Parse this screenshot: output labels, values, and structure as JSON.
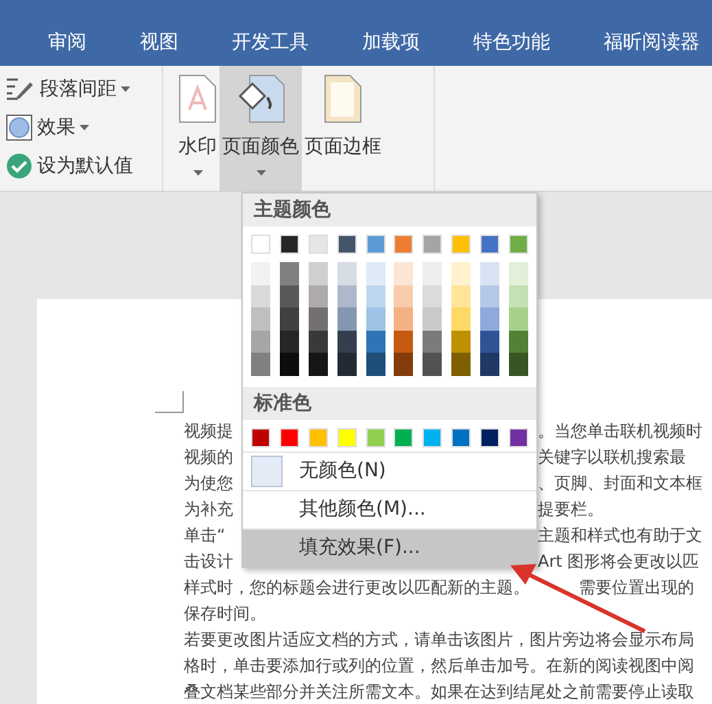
{
  "tabs": [
    {
      "label": "审阅",
      "selected": false
    },
    {
      "label": "视图",
      "selected": false
    },
    {
      "label": "开发工具",
      "selected": false
    },
    {
      "label": "加载项",
      "selected": false
    },
    {
      "label": "特色功能",
      "selected": false
    },
    {
      "label": "福昕阅读器",
      "selected": false
    }
  ],
  "ribbon": {
    "small_buttons": [
      {
        "kind": "spacing",
        "label": "段落间距",
        "dropdown": true
      },
      {
        "kind": "effects",
        "label": "效果",
        "dropdown": true
      },
      {
        "kind": "default",
        "label": "设为默认值",
        "dropdown": false
      }
    ],
    "large_buttons": [
      {
        "kind": "watermark",
        "label": "水印",
        "dropdown": true,
        "active": false
      },
      {
        "kind": "page-color",
        "label": "页面颜色",
        "dropdown": true,
        "active": true
      },
      {
        "kind": "page-border",
        "label": "页面边框",
        "dropdown": false,
        "active": false
      }
    ]
  },
  "document": {
    "lines": [
      {
        "kind": "under-menu",
        "left": "视频提",
        "right": "。当您单击联机视频时"
      },
      {
        "kind": "under-menu",
        "left": "视频的",
        "right": "关键字以联机搜索最"
      },
      {
        "kind": "under-menu",
        "left": "为使您",
        "right": "、页脚、封面和文本框"
      },
      {
        "kind": "under-menu",
        "left": "为补充",
        "right": "提要栏。"
      },
      {
        "kind": "under-menu",
        "left": "单击“",
        "right": "主题和样式也有助于文"
      },
      {
        "kind": "under-menu",
        "left": "击设计",
        "right": "Art 图形将会更改以匹"
      },
      {
        "kind": "under-arrow",
        "left": "样式时，您的标题会进行更改以匹配新的主题。",
        "right": "需要位置出现的"
      },
      {
        "kind": "full",
        "text": "保存时间。"
      },
      {
        "kind": "full",
        "text": "若要更改图片适应文档的方式，请单击该图片，图片旁边将会显示布局"
      },
      {
        "kind": "full",
        "text": "格时，单击要添加行或列的位置，然后单击加号。在新的阅读视图中阅"
      },
      {
        "kind": "full",
        "text": "叠文档某些部分并关注所需文本。如果在达到结尾处之前需要停止读取"
      }
    ]
  },
  "color_menu": {
    "theme_title": "主题颜色",
    "theme_colors": [
      {
        "color": "#ffffff",
        "shades": [
          {
            "color": "#f2f2f2"
          },
          {
            "color": "#d9d9d9"
          },
          {
            "color": "#bfbfbf"
          },
          {
            "color": "#a6a6a6"
          },
          {
            "color": "#808080"
          }
        ]
      },
      {
        "color": "#262626",
        "shades": [
          {
            "color": "#808080"
          },
          {
            "color": "#595959"
          },
          {
            "color": "#404040"
          },
          {
            "color": "#262626"
          },
          {
            "color": "#0d0d0d"
          }
        ]
      },
      {
        "color": "#e7e6e6",
        "shades": [
          {
            "color": "#d0cece"
          },
          {
            "color": "#aeaaaa"
          },
          {
            "color": "#757070"
          },
          {
            "color": "#3a3838"
          },
          {
            "color": "#171616"
          }
        ]
      },
      {
        "color": "#44546a",
        "shades": [
          {
            "color": "#d6dce4"
          },
          {
            "color": "#adb9ca"
          },
          {
            "color": "#8497b0"
          },
          {
            "color": "#333f4f"
          },
          {
            "color": "#222a35"
          }
        ]
      },
      {
        "color": "#5b9bd5",
        "shades": [
          {
            "color": "#deebf6"
          },
          {
            "color": "#bdd7ee"
          },
          {
            "color": "#9dc3e6"
          },
          {
            "color": "#2e75b5"
          },
          {
            "color": "#1f4e79"
          }
        ]
      },
      {
        "color": "#ed7d31",
        "shades": [
          {
            "color": "#fbe5d5"
          },
          {
            "color": "#f7cbac"
          },
          {
            "color": "#f4b183"
          },
          {
            "color": "#c55a11"
          },
          {
            "color": "#843c0b"
          }
        ]
      },
      {
        "color": "#a5a5a5",
        "shades": [
          {
            "color": "#ededed"
          },
          {
            "color": "#dbdbdb"
          },
          {
            "color": "#c9c9c9"
          },
          {
            "color": "#7b7b7b"
          },
          {
            "color": "#525252"
          }
        ]
      },
      {
        "color": "#ffc000",
        "shades": [
          {
            "color": "#fff2cc"
          },
          {
            "color": "#fee599"
          },
          {
            "color": "#ffd965"
          },
          {
            "color": "#bf9000"
          },
          {
            "color": "#7f6000"
          }
        ]
      },
      {
        "color": "#4472c4",
        "shades": [
          {
            "color": "#dae3f3"
          },
          {
            "color": "#b4c7e7"
          },
          {
            "color": "#8eaadb"
          },
          {
            "color": "#2f5496"
          },
          {
            "color": "#1f3864"
          }
        ]
      },
      {
        "color": "#70ad47",
        "shades": [
          {
            "color": "#e2efd9"
          },
          {
            "color": "#c5e0b3"
          },
          {
            "color": "#a8d08d"
          },
          {
            "color": "#538135"
          },
          {
            "color": "#375623"
          }
        ]
      }
    ],
    "standard_title": "标准色",
    "standard_colors": [
      {
        "color": "#c00000"
      },
      {
        "color": "#ff0000"
      },
      {
        "color": "#ffc000"
      },
      {
        "color": "#ffff00"
      },
      {
        "color": "#92d050"
      },
      {
        "color": "#00b050"
      },
      {
        "color": "#00b0f0"
      },
      {
        "color": "#0070c0"
      },
      {
        "color": "#002060"
      },
      {
        "color": "#7030a0"
      }
    ],
    "items": [
      {
        "kind": "no-color",
        "label": "无颜色(N)",
        "highlighted": false
      },
      {
        "kind": "plain",
        "label": "其他颜色(M)...",
        "highlighted": false
      },
      {
        "kind": "plain",
        "label": "填充效果(F)...",
        "highlighted": true
      }
    ]
  }
}
